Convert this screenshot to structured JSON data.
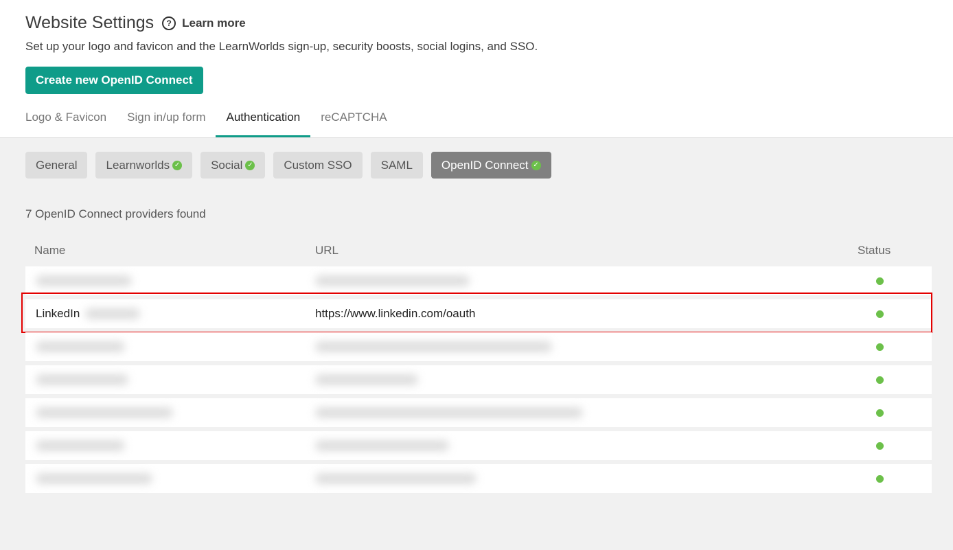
{
  "header": {
    "title": "Website Settings",
    "help_icon": "?",
    "learn_more": "Learn more",
    "subtitle": "Set up your logo and favicon and the LearnWorlds sign-up, security boosts, social logins, and SSO.",
    "create_button": "Create new OpenID Connect",
    "tabs": [
      {
        "label": "Logo & Favicon",
        "active": false
      },
      {
        "label": "Sign in/up form",
        "active": false
      },
      {
        "label": "Authentication",
        "active": true
      },
      {
        "label": "reCAPTCHA",
        "active": false
      }
    ]
  },
  "subtabs": [
    {
      "label": "General",
      "enabled": false,
      "active": false
    },
    {
      "label": "Learnworlds",
      "enabled": true,
      "active": false
    },
    {
      "label": "Social",
      "enabled": true,
      "active": false
    },
    {
      "label": "Custom SSO",
      "enabled": false,
      "active": false
    },
    {
      "label": "SAML",
      "enabled": false,
      "active": false
    },
    {
      "label": "OpenID Connect",
      "enabled": true,
      "active": true
    }
  ],
  "providers_count": "7 OpenID Connect providers found",
  "table": {
    "columns": [
      "Name",
      "URL",
      "Status"
    ],
    "rows": [
      {
        "name": "",
        "url": "",
        "status": "active"
      },
      {
        "name": "LinkedIn",
        "url": "https://www.linkedin.com/oauth",
        "status": "active"
      },
      {
        "name": "",
        "url": "",
        "status": "active"
      },
      {
        "name": "",
        "url": "",
        "status": "active"
      },
      {
        "name": "",
        "url": "",
        "status": "active"
      },
      {
        "name": "",
        "url": "",
        "status": "active"
      },
      {
        "name": "",
        "url": "",
        "status": "active"
      }
    ]
  },
  "colors": {
    "accent": "#0f9c89",
    "status_green": "#6cc04a",
    "highlight_red": "#e30000"
  },
  "icons": {
    "help": "help-circle-icon",
    "check": "check-circle-icon",
    "status": "status-dot-icon"
  }
}
